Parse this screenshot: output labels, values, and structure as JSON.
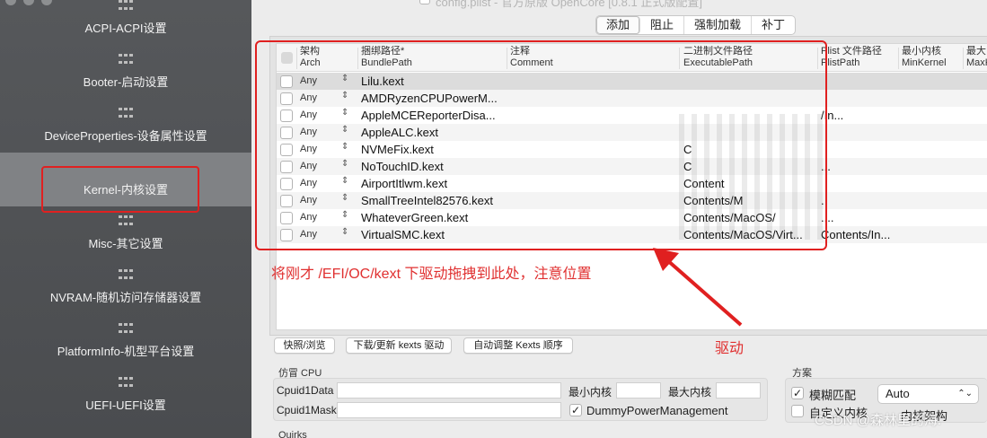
{
  "window": {
    "title": "config.plist - 官方原版 OpenCore [0.8.1 正式版配置]"
  },
  "sidebar": {
    "items": [
      {
        "label": "ACPI-ACPI设置"
      },
      {
        "label": "Booter-启动设置"
      },
      {
        "label": "DeviceProperties-设备属性设置"
      },
      {
        "label": "Kernel-内核设置",
        "active": true
      },
      {
        "label": "Misc-其它设置"
      },
      {
        "label": "NVRAM-随机访问存储器设置"
      },
      {
        "label": "PlatformInfo-机型平台设置"
      },
      {
        "label": "UEFI-UEFI设置"
      }
    ]
  },
  "tabs": [
    "添加",
    "阻止",
    "强制加载",
    "补丁"
  ],
  "table": {
    "headers": [
      {
        "cn": "架构",
        "en": "Arch"
      },
      {
        "cn": "捆绑路径*",
        "en": "BundlePath"
      },
      {
        "cn": "注释",
        "en": "Comment"
      },
      {
        "cn": "二进制文件路径",
        "en": "ExecutablePath"
      },
      {
        "cn": "Plist 文件路径",
        "en": "PlistPath"
      },
      {
        "cn": "最小内核",
        "en": "MinKernel"
      },
      {
        "cn": "最大",
        "en": "MaxK"
      }
    ],
    "rows": [
      {
        "arch": "Any",
        "bundle": "Lilu.kext",
        "exec": "",
        "plist": ""
      },
      {
        "arch": "Any",
        "bundle": "AMDRyzenCPUPowerM...",
        "exec": "",
        "plist": ""
      },
      {
        "arch": "Any",
        "bundle": "AppleMCEReporterDisa...",
        "exec": "",
        "plist": "/In..."
      },
      {
        "arch": "Any",
        "bundle": "AppleALC.kext",
        "exec": "",
        "plist": ""
      },
      {
        "arch": "Any",
        "bundle": "NVMeFix.kext",
        "exec": "C",
        "plist": ""
      },
      {
        "arch": "Any",
        "bundle": "NoTouchID.kext",
        "exec": "C",
        "plist": "..."
      },
      {
        "arch": "Any",
        "bundle": "AirportItlwm.kext",
        "exec": "Content",
        "plist": ""
      },
      {
        "arch": "Any",
        "bundle": "SmallTreeIntel82576.kext",
        "exec": "Contents/M",
        "plist": "."
      },
      {
        "arch": "Any",
        "bundle": "WhateverGreen.kext",
        "exec": "Contents/MacOS/",
        "plist": "...."
      },
      {
        "arch": "Any",
        "bundle": "VirtualSMC.kext",
        "exec": "Contents/MacOS/Virt...",
        "plist": "Contents/In..."
      }
    ]
  },
  "annotations": {
    "instruction": "将刚才 /EFI/OC/kext 下驱动拖拽到此处，注意位置",
    "driver": "驱动"
  },
  "buttons": {
    "browse": "快照/浏览",
    "download": "下载/更新 kexts 驱动",
    "auto_order": "自动调整 Kexts 顺序"
  },
  "emulate": {
    "title": "仿冒 CPU",
    "cpuid1data": "Cpuid1Data",
    "cpuid1mask": "Cpuid1Mask",
    "min_kernel": "最小内核",
    "max_kernel": "最大内核",
    "dummy_power": "DummyPowerManagement",
    "dummy_power_checked": true
  },
  "scheme": {
    "title": "方案",
    "fuzzy_match": "模糊匹配",
    "fuzzy_match_checked": true,
    "custom_kernel": "自定义内核",
    "custom_kernel_checked": false,
    "arch_value": "Auto",
    "kernel_arch": "内核架构"
  },
  "quirks": {
    "title": "Quirks"
  },
  "watermark": "CSDN @森林里的海."
}
